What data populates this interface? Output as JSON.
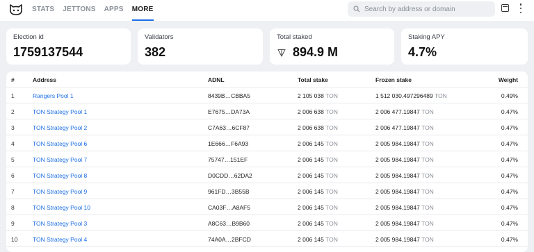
{
  "nav": {
    "items": [
      {
        "label": "STATS",
        "active": false
      },
      {
        "label": "JETTONS",
        "active": false
      },
      {
        "label": "APPS",
        "active": false
      },
      {
        "label": "MORE",
        "active": true
      }
    ]
  },
  "search": {
    "placeholder": "Search by address or domain"
  },
  "cards": {
    "election": {
      "label": "Election id",
      "value": "1759137544"
    },
    "validators": {
      "label": "Validators",
      "value": "382"
    },
    "total_staked": {
      "label": "Total staked",
      "value": "894.9 M"
    },
    "apy": {
      "label": "Staking APY",
      "value": "4.7%"
    }
  },
  "table": {
    "headers": {
      "idx": "#",
      "address": "Address",
      "adnl": "ADNL",
      "total": "Total stake",
      "frozen": "Frozen stake",
      "weight": "Weight"
    },
    "unit": "TON",
    "rows": [
      {
        "idx": "1",
        "address": "Rangers Pool 1",
        "adnl": "8439B…CBBA5",
        "total": "2 105 038",
        "frozen": "1 512 030.497296489",
        "weight": "0.49%"
      },
      {
        "idx": "2",
        "address": "TON Strategy Pool 1",
        "adnl": "E7675…DA73A",
        "total": "2 006 638",
        "frozen": "2 006 477.19847",
        "weight": "0.47%"
      },
      {
        "idx": "3",
        "address": "TON Strategy Pool 2",
        "adnl": "C7A63…6CF87",
        "total": "2 006 638",
        "frozen": "2 006 477.19847",
        "weight": "0.47%"
      },
      {
        "idx": "4",
        "address": "TON Strategy Pool 6",
        "adnl": "1E666…F6A93",
        "total": "2 006 145",
        "frozen": "2 005 984.19847",
        "weight": "0.47%"
      },
      {
        "idx": "5",
        "address": "TON Strategy Pool 7",
        "adnl": "75747…151EF",
        "total": "2 006 145",
        "frozen": "2 005 984.19847",
        "weight": "0.47%"
      },
      {
        "idx": "6",
        "address": "TON Strategy Pool 8",
        "adnl": "D0CDD…62DA2",
        "total": "2 006 145",
        "frozen": "2 005 984.19847",
        "weight": "0.47%"
      },
      {
        "idx": "7",
        "address": "TON Strategy Pool 9",
        "adnl": "961FD…3B55B",
        "total": "2 006 145",
        "frozen": "2 005 984.19847",
        "weight": "0.47%"
      },
      {
        "idx": "8",
        "address": "TON Strategy Pool 10",
        "adnl": "CA03F…A8AF5",
        "total": "2 006 145",
        "frozen": "2 005 984.19847",
        "weight": "0.47%"
      },
      {
        "idx": "9",
        "address": "TON Strategy Pool 3",
        "adnl": "A8C63…B9B60",
        "total": "2 006 145",
        "frozen": "2 005 984.19847",
        "weight": "0.47%"
      },
      {
        "idx": "10",
        "address": "TON Strategy Pool 4",
        "adnl": "74A0A…2BFCD",
        "total": "2 006 145",
        "frozen": "2 005 984.19847",
        "weight": "0.47%"
      }
    ]
  },
  "icons": {
    "logo": "cat-logo-icon",
    "search": "search-icon",
    "theme": "theme-toggle-icon",
    "menu": "kebab-menu-icon",
    "ton": "ton-diamond-icon"
  },
  "colors": {
    "accent": "#1a6ee6",
    "background": "#eef0f3"
  }
}
